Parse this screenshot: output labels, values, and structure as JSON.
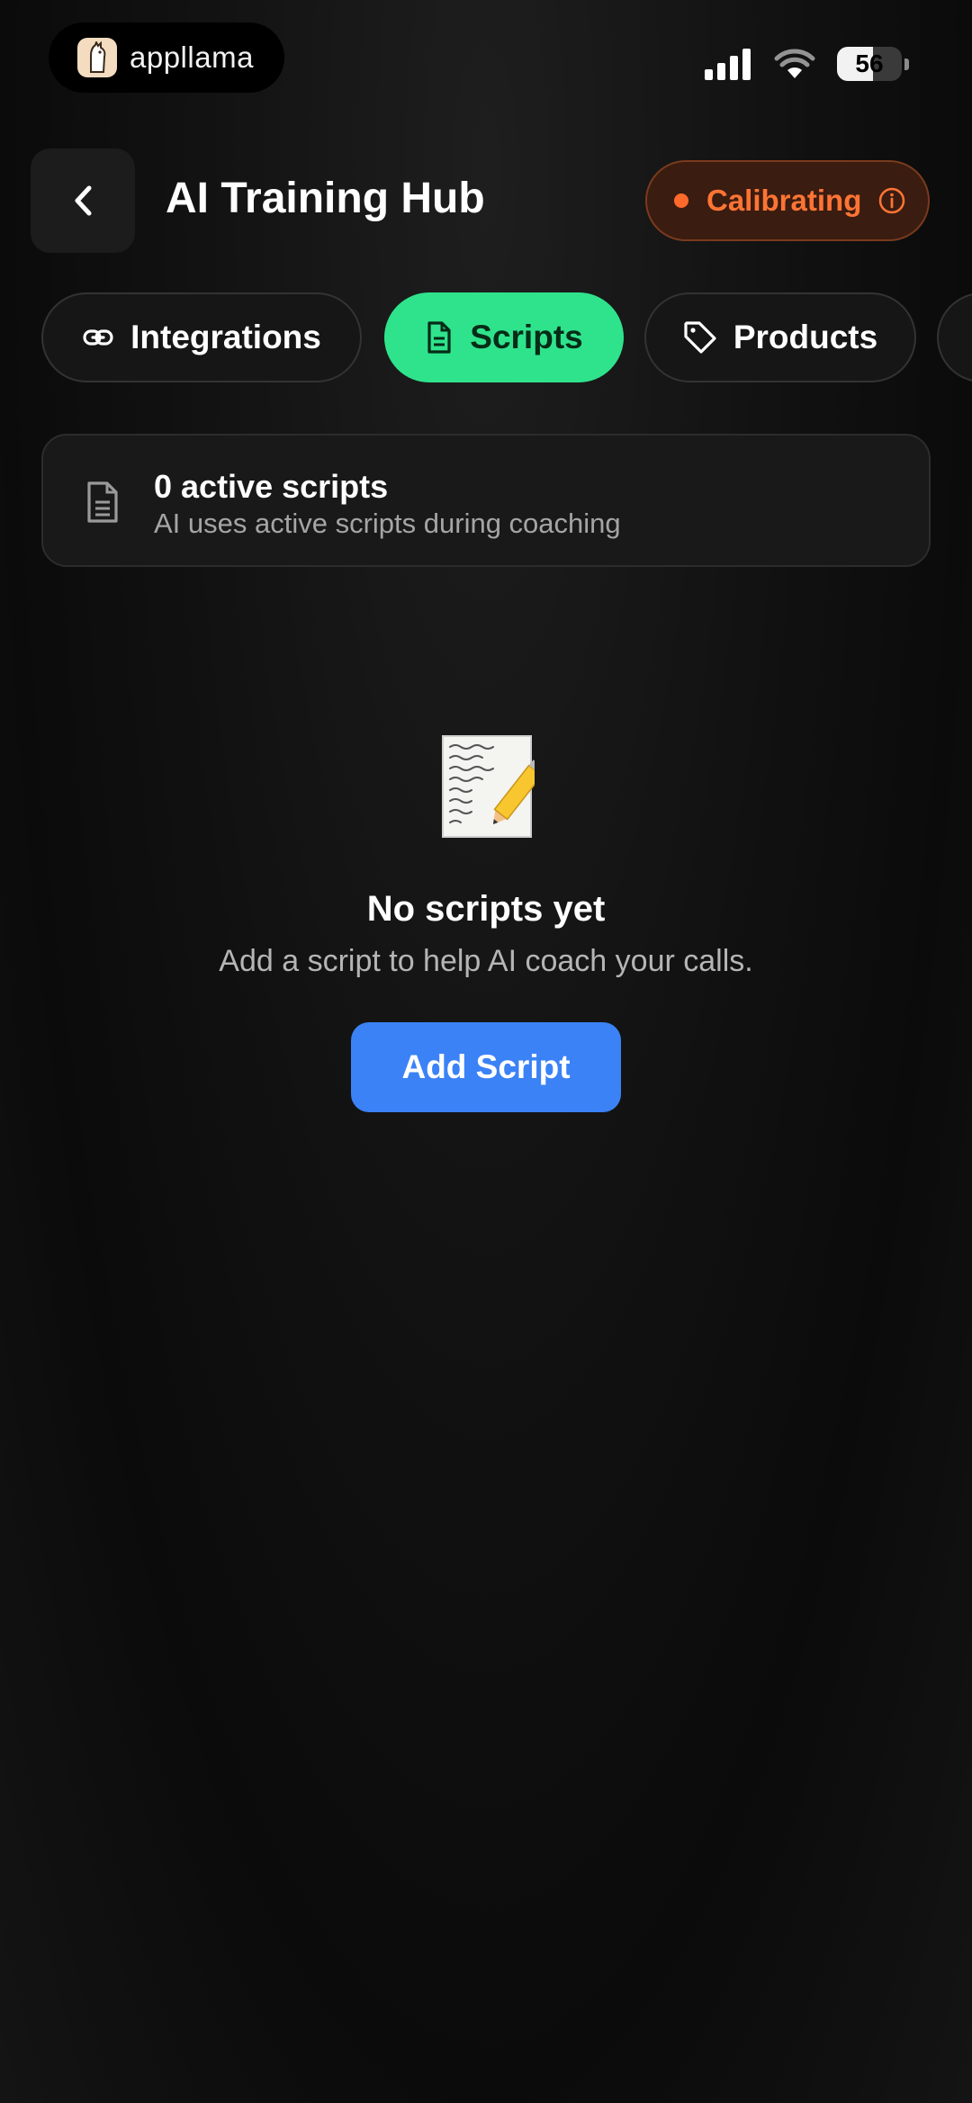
{
  "status_bar": {
    "brand_name": "appllama",
    "battery_level": "56"
  },
  "header": {
    "title": "AI Training Hub",
    "status_chip": "Calibrating"
  },
  "tabs": [
    {
      "label": "Integrations",
      "icon": "link-icon",
      "active": false
    },
    {
      "label": "Scripts",
      "icon": "document-icon",
      "active": true
    },
    {
      "label": "Products",
      "icon": "tag-icon",
      "active": false
    }
  ],
  "summary": {
    "count_text": "0 active scripts",
    "subtitle": "AI uses active scripts during coaching"
  },
  "empty_state": {
    "icon": "memo-icon",
    "title": "No scripts yet",
    "subtitle": "Add a script to help AI coach your calls.",
    "button_label": "Add Script"
  },
  "colors": {
    "accent_green": "#2fe38c",
    "primary_blue": "#3b82f6",
    "status_orange": "#ff7434"
  }
}
